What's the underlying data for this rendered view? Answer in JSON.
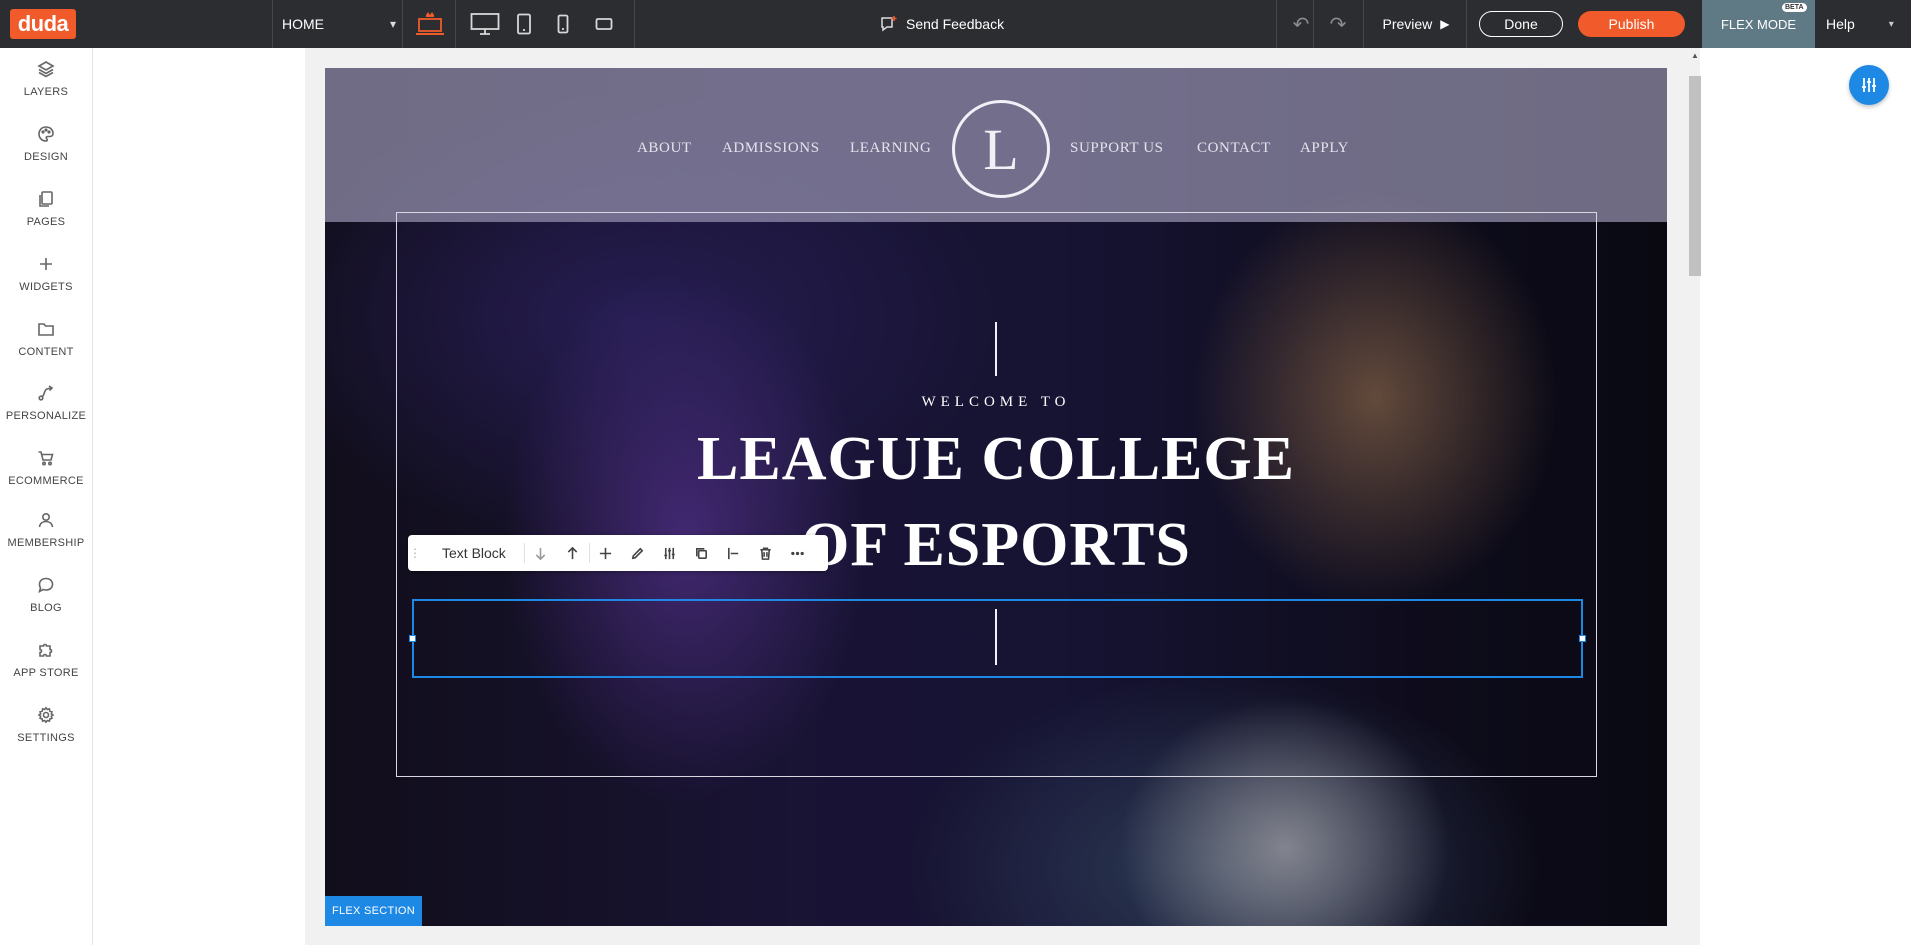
{
  "topbar": {
    "logo_text": "duda",
    "page_select": "HOME",
    "send_feedback": "Send Feedback",
    "preview": "Preview",
    "done": "Done",
    "publish": "Publish",
    "flex_mode": "FLEX MODE",
    "beta": "BETA",
    "help": "Help",
    "accent_color": "#f15a2b"
  },
  "sidebar": {
    "items": [
      {
        "label": "LAYERS",
        "icon": "layers-icon"
      },
      {
        "label": "DESIGN",
        "icon": "palette-icon"
      },
      {
        "label": "PAGES",
        "icon": "pages-icon"
      },
      {
        "label": "WIDGETS",
        "icon": "plus-icon"
      },
      {
        "label": "CONTENT",
        "icon": "folder-icon"
      },
      {
        "label": "PERSONALIZE",
        "icon": "personalize-icon"
      },
      {
        "label": "ECOMMERCE",
        "icon": "cart-icon"
      },
      {
        "label": "MEMBERSHIP",
        "icon": "user-icon"
      },
      {
        "label": "BLOG",
        "icon": "chat-bubble-icon"
      },
      {
        "label": "APP STORE",
        "icon": "puzzle-icon"
      },
      {
        "label": "SETTINGS",
        "icon": "gear-icon"
      }
    ]
  },
  "site": {
    "nav": {
      "about": "ABOUT",
      "admissions": "ADMISSIONS",
      "learning": "LEARNING",
      "support": "SUPPORT US",
      "contact": "CONTACT",
      "apply": "APPLY"
    },
    "logo_letter": "L",
    "welcome": "WELCOME TO",
    "title_line1": "LEAGUE COLLEGE",
    "title_line2": "OF ESPORTS"
  },
  "element_toolbar": {
    "label": "Text Block"
  },
  "flex_section_label": "FLEX SECTION",
  "selection_color": "#1e88e5"
}
